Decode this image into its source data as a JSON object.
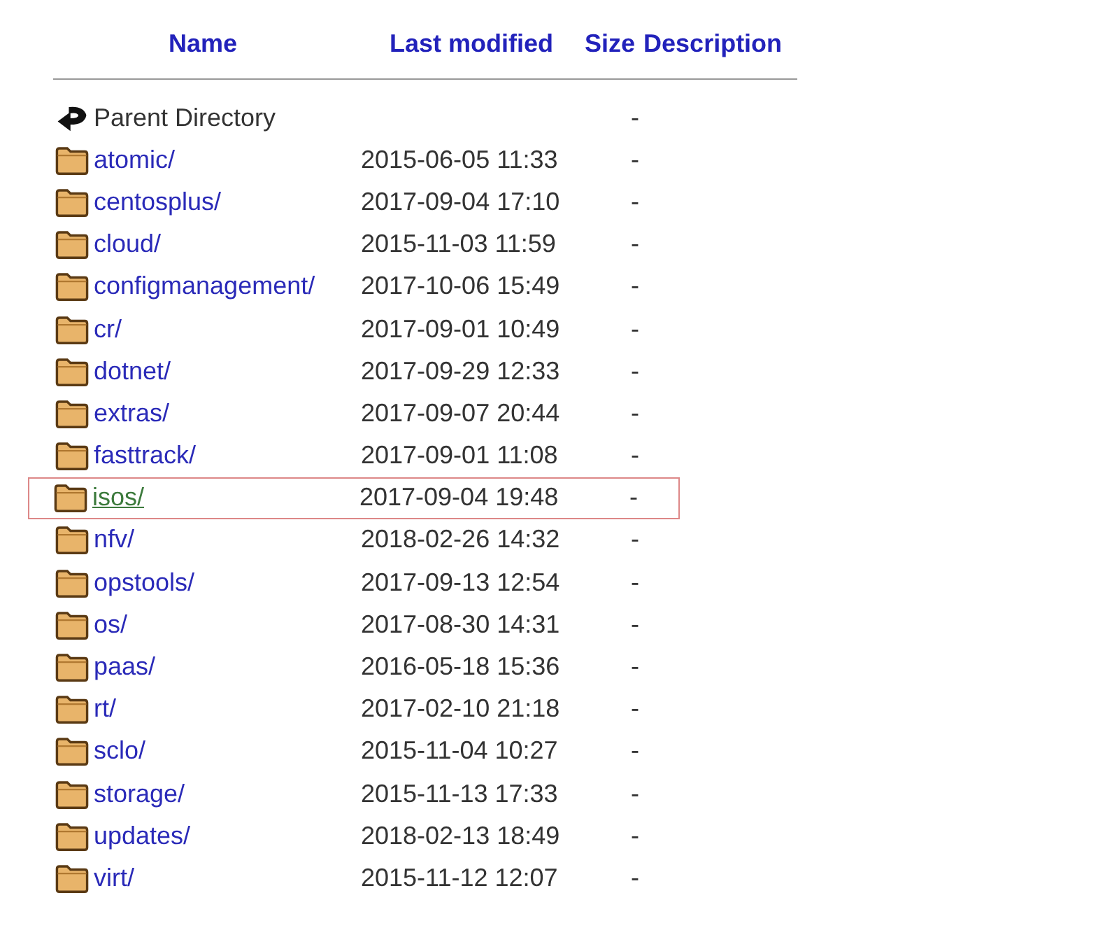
{
  "table": {
    "columns": [
      "Name",
      "Last modified",
      "Size",
      "Description"
    ],
    "rows": [
      {
        "kind": "parent",
        "name": "Parent Directory",
        "modified": "",
        "size": "-",
        "selected": false
      },
      {
        "kind": "folder",
        "name": "atomic/",
        "modified": "2015-06-05 11:33",
        "size": "-",
        "selected": false
      },
      {
        "kind": "folder",
        "name": "centosplus/",
        "modified": "2017-09-04 17:10",
        "size": "-",
        "selected": false
      },
      {
        "kind": "folder",
        "name": "cloud/",
        "modified": "2015-11-03 11:59",
        "size": "-",
        "selected": false
      },
      {
        "kind": "folder",
        "name": "configmanagement/",
        "modified": "2017-10-06 15:49",
        "size": "-",
        "selected": false
      },
      {
        "kind": "folder",
        "name": "cr/",
        "modified": "2017-09-01 10:49",
        "size": "-",
        "selected": false
      },
      {
        "kind": "folder",
        "name": "dotnet/",
        "modified": "2017-09-29 12:33",
        "size": "-",
        "selected": false
      },
      {
        "kind": "folder",
        "name": "extras/",
        "modified": "2017-09-07 20:44",
        "size": "-",
        "selected": false
      },
      {
        "kind": "folder",
        "name": "fasttrack/",
        "modified": "2017-09-01 11:08",
        "size": "-",
        "selected": false
      },
      {
        "kind": "folder",
        "name": "isos/",
        "modified": "2017-09-04 19:48",
        "size": "-",
        "selected": true
      },
      {
        "kind": "folder",
        "name": "nfv/",
        "modified": "2018-02-26 14:32",
        "size": "-",
        "selected": false
      },
      {
        "kind": "folder",
        "name": "opstools/",
        "modified": "2017-09-13 12:54",
        "size": "-",
        "selected": false
      },
      {
        "kind": "folder",
        "name": "os/",
        "modified": "2017-08-30 14:31",
        "size": "-",
        "selected": false
      },
      {
        "kind": "folder",
        "name": "paas/",
        "modified": "2016-05-18 15:36",
        "size": "-",
        "selected": false
      },
      {
        "kind": "folder",
        "name": "rt/",
        "modified": "2017-02-10 21:18",
        "size": "-",
        "selected": false
      },
      {
        "kind": "folder",
        "name": "sclo/",
        "modified": "2015-11-04 10:27",
        "size": "-",
        "selected": false
      },
      {
        "kind": "folder",
        "name": "storage/",
        "modified": "2015-11-13 17:33",
        "size": "-",
        "selected": false
      },
      {
        "kind": "folder",
        "name": "updates/",
        "modified": "2018-02-13 18:49",
        "size": "-",
        "selected": false
      },
      {
        "kind": "folder",
        "name": "virt/",
        "modified": "2015-11-12 12:07",
        "size": "-",
        "selected": false
      }
    ]
  }
}
